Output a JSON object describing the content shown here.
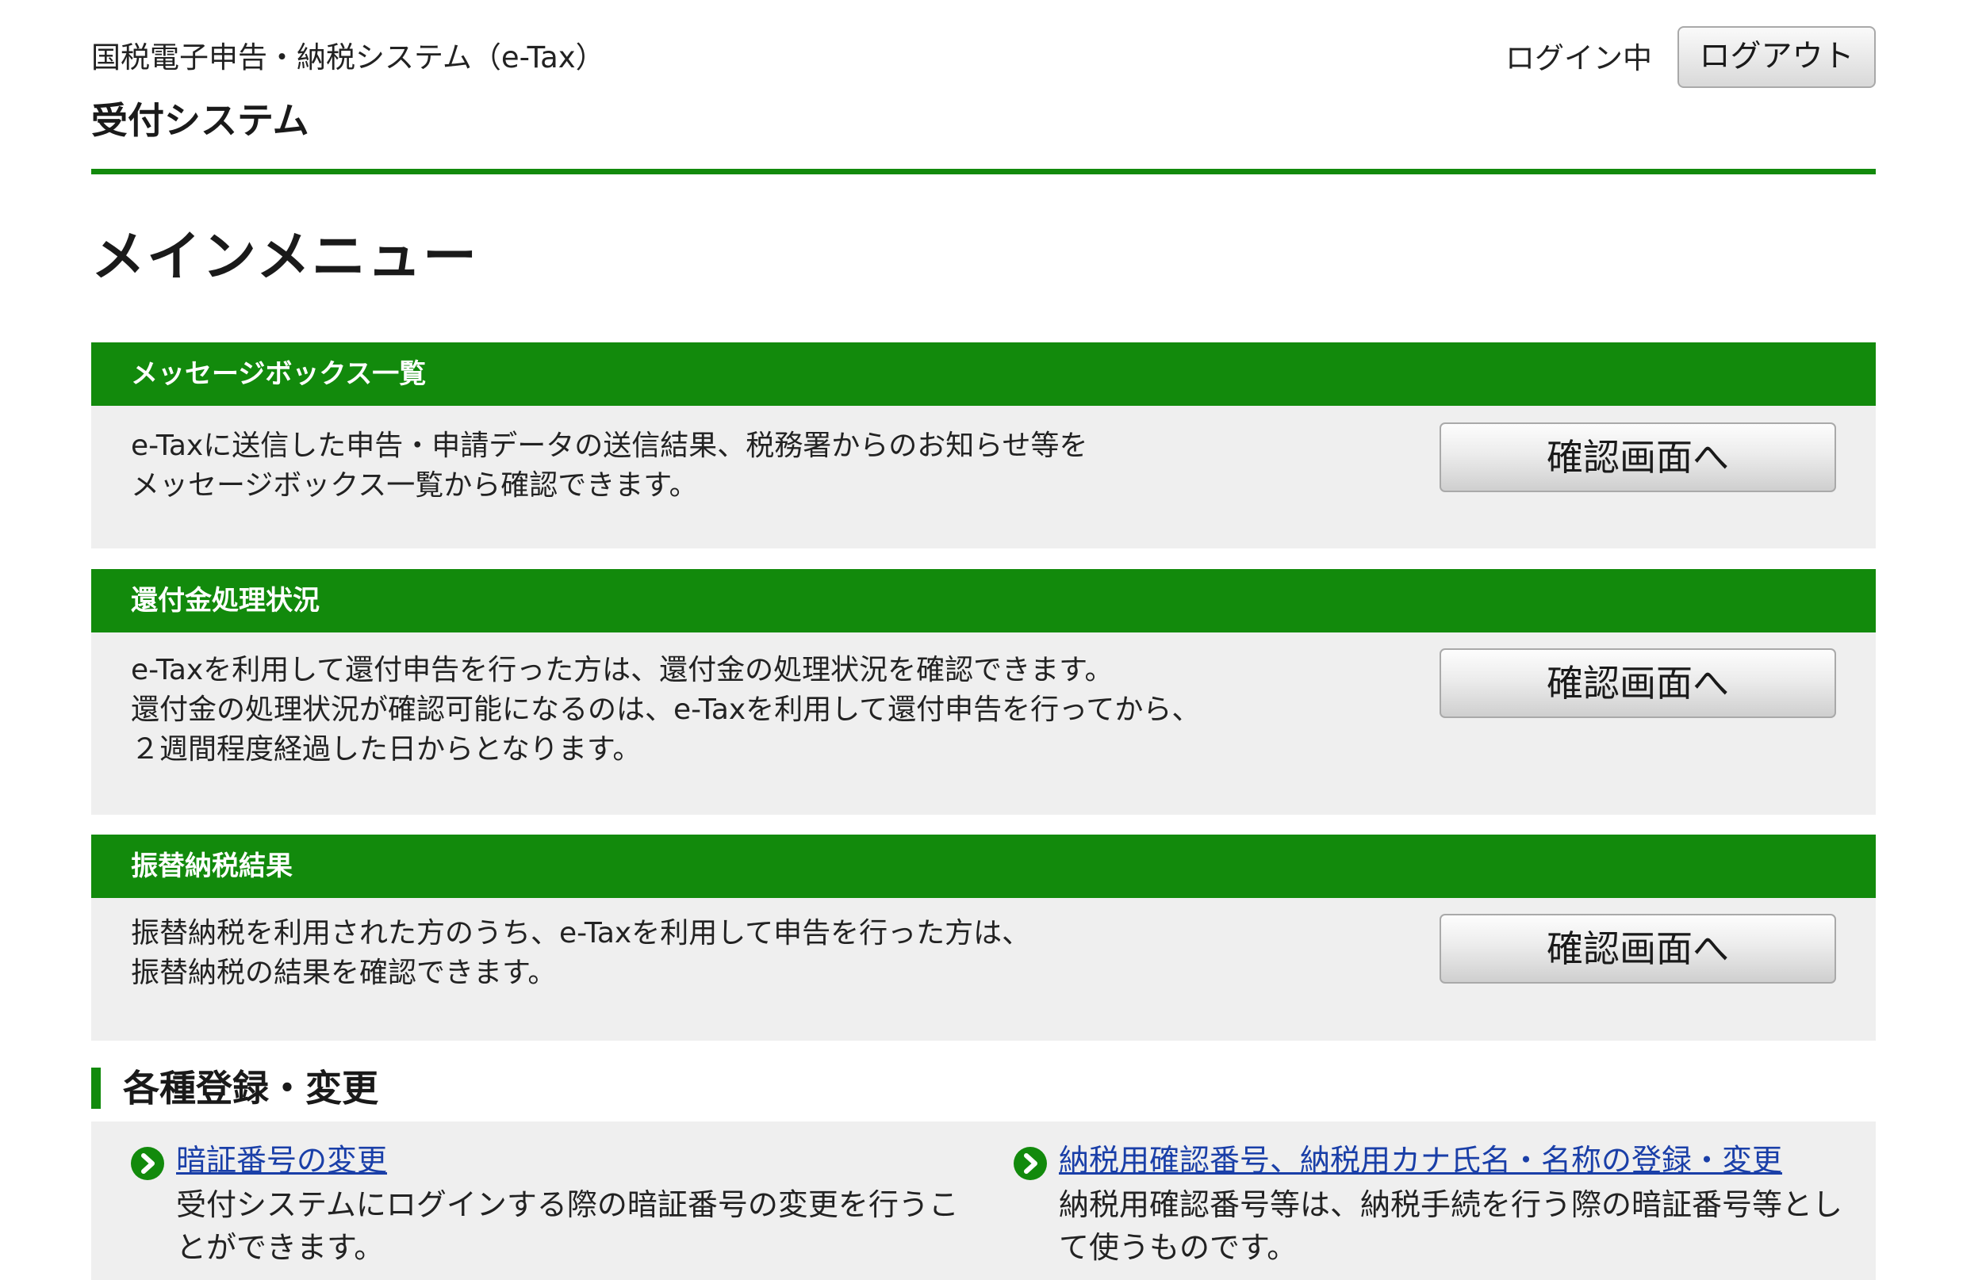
{
  "header": {
    "system_name": "国税電子申告・納税システム（e-Tax）",
    "sub_system": "受付システム",
    "login_status": "ログイン中",
    "logout_label": "ログアウト"
  },
  "page_title": "メインメニュー",
  "sections": [
    {
      "title": "メッセージボックス一覧",
      "lines": [
        "e-Taxに送信した申告・申請データの送信結果、税務署からのお知らせ等を",
        "メッセージボックス一覧から確認できます。"
      ],
      "button_label": "確認画面へ"
    },
    {
      "title": "還付金処理状況",
      "lines": [
        "e-Taxを利用して還付申告を行った方は、還付金の処理状況を確認できます。",
        "還付金の処理状況が確認可能になるのは、e-Taxを利用して還付申告を行ってから、",
        "２週間程度経過した日からとなります。"
      ],
      "button_label": "確認画面へ"
    },
    {
      "title": "振替納税結果",
      "lines": [
        "振替納税を利用された方のうち、e-Taxを利用して申告を行った方は、",
        "振替納税の結果を確認できます。"
      ],
      "button_label": "確認画面へ"
    }
  ],
  "registration": {
    "heading": "各種登録・変更",
    "items": [
      {
        "link": "暗証番号の変更",
        "lines": [
          "受付システムにログインする際の暗証番号の変更を行うこ",
          "とができます。"
        ]
      },
      {
        "link": "納税用確認番号、納税用カナ氏名・名称の登録・変更",
        "lines": [
          "納税用確認番号等は、納税手続を行う際の暗証番号等とし",
          "て使うものです。"
        ]
      }
    ]
  },
  "colors": {
    "accent_green": "#128a0c",
    "link_blue": "#1a3fa8",
    "panel_gray": "#efefef"
  },
  "icons": {
    "registration_bullet": "chevron-right-circle-icon"
  }
}
